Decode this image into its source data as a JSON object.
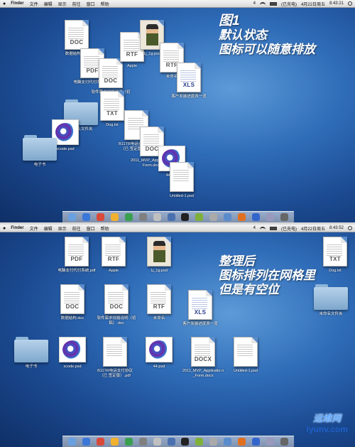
{
  "menubar": {
    "apple": "",
    "app": "Finder",
    "items": [
      "文件",
      "编辑",
      "显示",
      "前往",
      "窗口",
      "帮助"
    ],
    "status_count": "4",
    "user": "(已充电)",
    "date": "4月22日周五",
    "time_top": "8:43:21",
    "time_bottom": "8:43:52"
  },
  "top_annotation": {
    "title": "图1",
    "line1": "默认状态",
    "line2": "图标可以随意排放"
  },
  "bottom_annotation": {
    "line1": "整理后",
    "line2": "图标排列在网格里",
    "line3": "但是有空位"
  },
  "top_icons": [
    {
      "name": "doc-file",
      "type": "file",
      "badge": "DOC",
      "label": "数据结构.doc"
    },
    {
      "name": "pdf-file",
      "type": "file",
      "badge": "PDF",
      "label": "电脑支付代付系统.pdf"
    },
    {
      "name": "doc-file-2",
      "type": "file",
      "badge": "DOC",
      "label": "软件需求规格说明（初"
    },
    {
      "name": "rtf-apple",
      "type": "file",
      "badge": "RTF",
      "label": "Apple"
    },
    {
      "name": "photo-file",
      "type": "photo",
      "badge": "",
      "label": "1j_1g.psd"
    },
    {
      "name": "rtf-file",
      "type": "file",
      "badge": "RTF",
      "label": "未命名"
    },
    {
      "name": "xls-file",
      "type": "sheet",
      "badge": "XLS",
      "label": "客户发展进度表一览"
    },
    {
      "name": "folder-1",
      "type": "folder",
      "badge": "",
      "label": "未命名文件夹"
    },
    {
      "name": "txt-file",
      "type": "file",
      "badge": "TXT",
      "label": "Dog.txt"
    },
    {
      "name": "psd-xcode",
      "type": "psd",
      "badge": "",
      "label": "xcode.psd"
    },
    {
      "name": "pdf-b11",
      "type": "file",
      "badge": "",
      "label": "B11TR电话支付协议（已 签定版）.pdf"
    },
    {
      "name": "docx-file",
      "type": "file",
      "badge": "DOC",
      "label": "2011_MVP_Application_Form.docx"
    },
    {
      "name": "folder-ebook",
      "type": "folder",
      "badge": "",
      "label": "电子书"
    },
    {
      "name": "psd-44",
      "type": "psd",
      "badge": "",
      "label": "44.psd"
    },
    {
      "name": "psd-untitled",
      "type": "file",
      "badge": "",
      "label": "Untitled-1.psd"
    }
  ],
  "bottom_icons": [
    {
      "name": "pdf-file",
      "type": "file",
      "badge": "PDF",
      "label": "电脑支付代付系统.pdf"
    },
    {
      "name": "rtf-apple",
      "type": "file",
      "badge": "RTF",
      "label": "Apple"
    },
    {
      "name": "photo-file",
      "type": "photo",
      "badge": "",
      "label": "1j_1g.psd"
    },
    {
      "name": "txt-file",
      "type": "file",
      "badge": "TXT",
      "label": "Dog.txt"
    },
    {
      "name": "doc-file",
      "type": "file",
      "badge": "DOC",
      "label": "数据结构.doc"
    },
    {
      "name": "doc-file-2",
      "type": "file",
      "badge": "DOC",
      "label": "软件需求规格说明（初 稿）.doc"
    },
    {
      "name": "rtf-file",
      "type": "file",
      "badge": "RTF",
      "label": "未命名"
    },
    {
      "name": "xls-file",
      "type": "sheet",
      "badge": "XLS",
      "label": "客户发展进度表一览"
    },
    {
      "name": "folder-1",
      "type": "folder",
      "badge": "",
      "label": "未命名文件夹"
    },
    {
      "name": "folder-ebook",
      "type": "folder",
      "badge": "",
      "label": "电子书"
    },
    {
      "name": "psd-xcode",
      "type": "psd",
      "badge": "",
      "label": "xcode.psd"
    },
    {
      "name": "pdf-b11",
      "type": "file",
      "badge": "",
      "label": "B11TR电话支付协议（已 签定版）.pdf"
    },
    {
      "name": "psd-44",
      "type": "psd",
      "badge": "",
      "label": "44.psd"
    },
    {
      "name": "docx-file",
      "type": "file",
      "badge": "DOCX",
      "label": "2011_MVP_Applicatio n_Form.docx"
    },
    {
      "name": "psd-untitled",
      "type": "file",
      "badge": "",
      "label": "Untitled-1.psd"
    }
  ],
  "dock_colors": [
    "#6aa0e0",
    "#3b77d8",
    "#d84a3a",
    "#f0b030",
    "#3aa050",
    "#808080",
    "#c0c0c0",
    "#4a70b0",
    "#222222",
    "#7fb03a",
    "#aaa",
    "#5a8ccc",
    "#e07020",
    "#3366cc",
    "#99b",
    "#666"
  ],
  "watermark": {
    "logo": "运维网",
    "site": "iyunv.com"
  }
}
